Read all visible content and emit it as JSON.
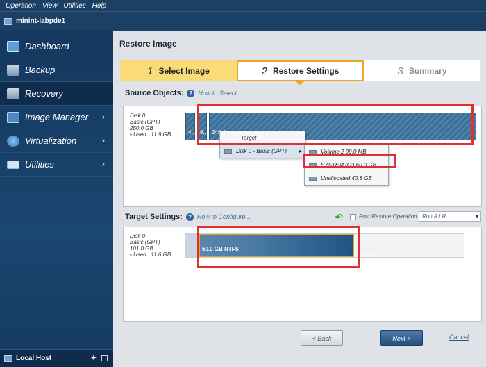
{
  "menubar": {
    "items": [
      "Operation",
      "View",
      "Utilities",
      "Help"
    ]
  },
  "window": {
    "title": "minint-iabpde1"
  },
  "sidebar": {
    "items": [
      {
        "label": "Dashboard",
        "active": false,
        "icon": "monitor-icon"
      },
      {
        "label": "Backup",
        "active": false,
        "icon": "backup-icon"
      },
      {
        "label": "Recovery",
        "active": true,
        "icon": "recovery-icon"
      },
      {
        "label": "Image Manager",
        "active": false,
        "icon": "image-manager-icon",
        "chevron": "›"
      },
      {
        "label": "Virtualization",
        "active": false,
        "icon": "virtualization-icon",
        "chevron": "›"
      },
      {
        "label": "Utilities",
        "active": false,
        "icon": "utilities-icon",
        "chevron": "›"
      }
    ],
    "footer": {
      "label": "Local Host"
    }
  },
  "main": {
    "title": "Restore Image",
    "steps": [
      {
        "num": "1",
        "label": "Select Image",
        "state": "done"
      },
      {
        "num": "2",
        "label": "Restore Settings",
        "state": "current"
      },
      {
        "num": "3",
        "label": "Summary",
        "state": "pending"
      }
    ],
    "source": {
      "label": "Source Objects:",
      "help": "How to Select...",
      "disk": {
        "name": "Disk 0",
        "type": "Basic (GPT)",
        "size": "250.0 GB",
        "used": "Used : 11.9 GB"
      },
      "partitions": [
        {
          "label": "4..."
        },
        {
          "label": "9..."
        },
        {
          "label": "249.4..."
        }
      ],
      "menu1": {
        "items": [
          "Target",
          "Disk 0 - Basic (GPT)"
        ]
      },
      "menu2": {
        "items": [
          "Volume 2 99.0 MB",
          "SYSTEM (C:) 60.0 GB",
          "Unallocated 40.8 GB"
        ]
      }
    },
    "target": {
      "label": "Target Settings:",
      "help": "How to Configure...",
      "post_restore_label": "Post Restore Operation",
      "post_restore_value": "Run A.I.R",
      "disk": {
        "name": "Disk 0",
        "type": "Basic (GPT)",
        "size": "101.0 GB",
        "used": "Used : 11.6 GB"
      },
      "partition_label": "60.0 GB NTFS",
      "unallocated_label": "40.8 GB"
    },
    "buttons": {
      "back": "< Back",
      "next": "Next >",
      "cancel": "Cancel"
    }
  },
  "colors": {
    "nav_bg": "#1b4670",
    "step_done": "#f9dc78",
    "step_current_border": "#f0a22c",
    "highlight": "#e03131"
  }
}
